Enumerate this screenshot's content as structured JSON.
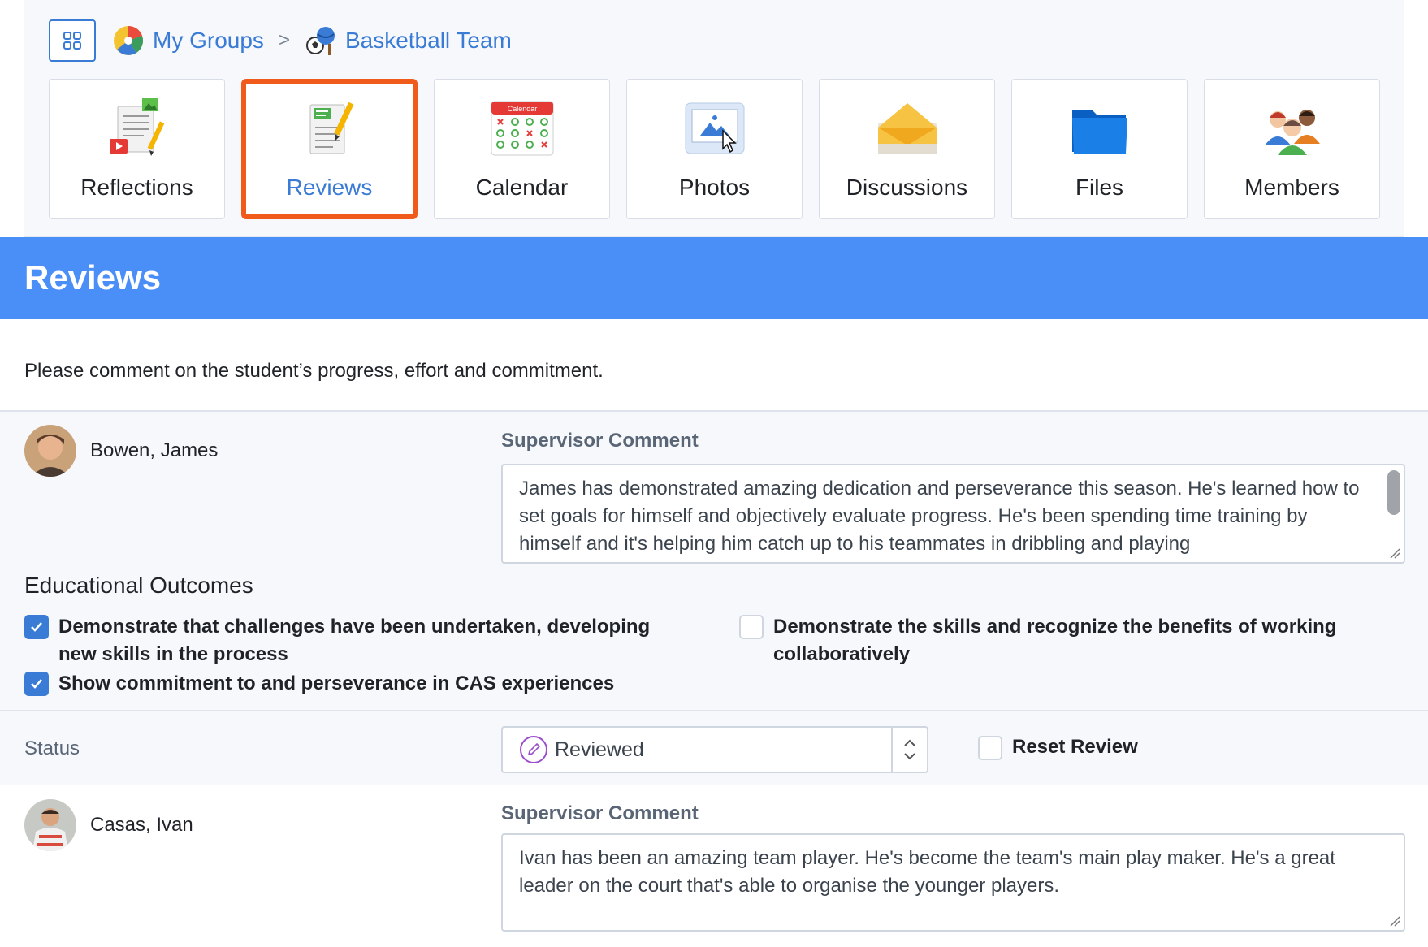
{
  "breadcrumb": {
    "apps_icon": "grid-icon",
    "groups_label": "My Groups",
    "groups_icon": "groups-icon",
    "group_label": "Basketball Team",
    "group_icon": "sports-balls-icon",
    "separator": ">"
  },
  "tiles": [
    {
      "label": "Reflections",
      "icon": "reflections-icon",
      "active": false
    },
    {
      "label": "Reviews",
      "icon": "reviews-icon",
      "active": true
    },
    {
      "label": "Calendar",
      "icon": "calendar-icon",
      "active": false
    },
    {
      "label": "Photos",
      "icon": "photos-icon",
      "active": false
    },
    {
      "label": "Discussions",
      "icon": "discussions-icon",
      "active": false
    },
    {
      "label": "Files",
      "icon": "files-icon",
      "active": false
    },
    {
      "label": "Members",
      "icon": "members-icon",
      "active": false
    }
  ],
  "calendar_icon_text": "Calendar",
  "page": {
    "title": "Reviews",
    "intro": "Please comment on the student’s progress, effort and commitment."
  },
  "students": [
    {
      "name": "Bowen, James",
      "comment_label": "Supervisor Comment",
      "comment": "James has demonstrated amazing dedication and perseverance this season. He's learned how to set goals for himself and objectively evaluate progress. He's been spending time training by himself and it's helping him catch up to his teammates in dribbling and playing",
      "outcomes_title": "Educational Outcomes",
      "outcomes": [
        {
          "text": "Demonstrate that challenges have been undertaken, developing new skills in the process",
          "checked": true
        },
        {
          "text": "Show commitment to and perseverance in CAS experiences",
          "checked": true
        },
        {
          "text": "Demonstrate the skills and recognize the benefits of working collaboratively",
          "checked": false
        }
      ],
      "status_label": "Status",
      "status_value": "Reviewed",
      "reset_label": "Reset Review",
      "reset_checked": false
    },
    {
      "name": "Casas, Ivan",
      "comment_label": "Supervisor Comment",
      "comment": "Ivan has been an amazing team player. He's become the team's main play maker. He's a great leader on the court that's able to organise the younger players."
    }
  ],
  "colors": {
    "accent": "#3a7bd5",
    "band": "#4a8ef7",
    "active_tile_border": "#f05a1a",
    "panel_bg": "#f6f8fc"
  }
}
